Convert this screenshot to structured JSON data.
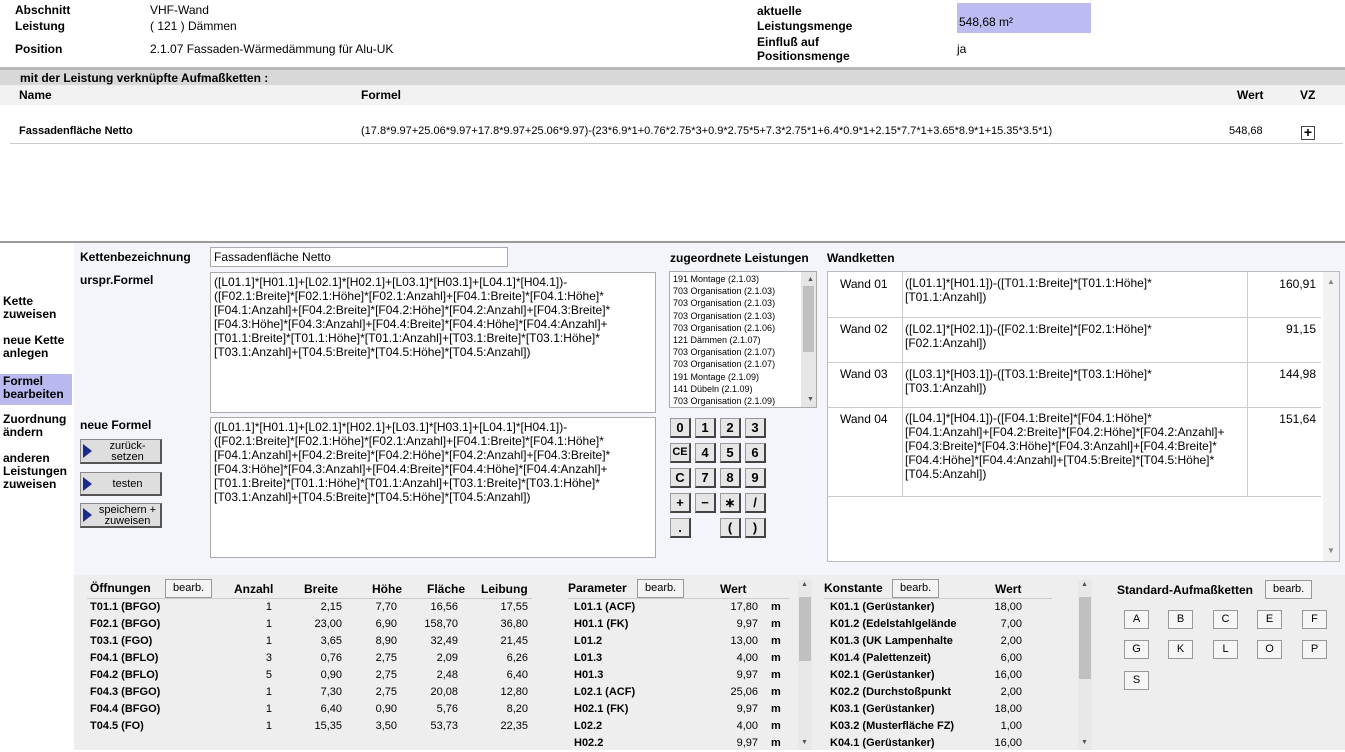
{
  "header": {
    "abschnitt_label": "Abschnitt",
    "abschnitt_value": "VHF-Wand",
    "leistung_label": "Leistung",
    "leistung_value": "( 121 ) Dämmen",
    "position_label": "Position",
    "position_value": "2.1.07 Fassaden-Wärmedämmung für Alu-UK",
    "aktuelle_label": "aktuelle",
    "leistungsmenge_label": "Leistungsmenge",
    "leistungsmenge_value": "548,68 m²",
    "einfluss_label_1": "Einfluß auf",
    "einfluss_label_2": "Positionsmenge",
    "einfluss_value": "ja"
  },
  "chains": {
    "section_title": "mit der Leistung verknüpfte Aufmaßketten :",
    "col_name": "Name",
    "col_formel": "Formel",
    "col_wert": "Wert",
    "col_vz": "VZ",
    "row": {
      "name": "Fassadenfläche Netto",
      "formel": "(17.8*9.97+25.06*9.97+17.8*9.97+25.06*9.97)-(23*6.9*1+0.76*2.75*3+0.9*2.75*5+7.3*2.75*1+6.4*0.9*1+2.15*7.7*1+3.65*8.9*1+15.35*3.5*1)",
      "wert": "548,68",
      "vz": "+"
    }
  },
  "sidebar": {
    "items": [
      {
        "label": "Kette\nzuweisen"
      },
      {
        "label": "neue Kette\nanlegen"
      },
      {
        "label": "Formel\nbearbeiten"
      },
      {
        "label": "Zuordnung\nändern"
      },
      {
        "label": "anderen\nLeistungen\nzuweisen"
      }
    ]
  },
  "editor": {
    "kettenbez_label": "Kettenbezeichnung",
    "kettenbez_value": "Fassadenfläche Netto",
    "urspr_label": "urspr.Formel",
    "urspr_value": "([L01.1]*[H01.1]+[L02.1]*[H02.1]+[L03.1]*[H03.1]+[L04.1]*[H04.1])-\n([F02.1:Breite]*[F02.1:Höhe]*[F02.1:Anzahl]+[F04.1:Breite]*[F04.1:Höhe]*\n[F04.1:Anzahl]+[F04.2:Breite]*[F04.2:Höhe]*[F04.2:Anzahl]+[F04.3:Breite]*\n[F04.3:Höhe]*[F04.3:Anzahl]+[F04.4:Breite]*[F04.4:Höhe]*[F04.4:Anzahl]+\n[T01.1:Breite]*[T01.1:Höhe]*[T01.1:Anzahl]+[T03.1:Breite]*[T03.1:Höhe]*\n[T03.1:Anzahl]+[T04.5:Breite]*[T04.5:Höhe]*[T04.5:Anzahl])",
    "neue_label": "neue Formel",
    "neue_value": "([L01.1]*[H01.1]+[L02.1]*[H02.1]+[L03.1]*[H03.1]+[L04.1]*[H04.1])-\n([F02.1:Breite]*[F02.1:Höhe]*[F02.1:Anzahl]+[F04.1:Breite]*[F04.1:Höhe]*\n[F04.1:Anzahl]+[F04.2:Breite]*[F04.2:Höhe]*[F04.2:Anzahl]+[F04.3:Breite]*\n[F04.3:Höhe]*[F04.3:Anzahl]+[F04.4:Breite]*[F04.4:Höhe]*[F04.4:Anzahl]+\n[T01.1:Breite]*[T01.1:Höhe]*[T01.1:Anzahl]+[T03.1:Breite]*[T03.1:Höhe]*\n[T03.1:Anzahl]+[T04.5:Breite]*[T04.5:Höhe]*[T04.5:Anzahl])",
    "btn_reset": "zurück-\nsetzen",
    "btn_test": "testen",
    "btn_save": "speichern +\nzuweisen"
  },
  "assigned": {
    "title": "zugeordnete Leistungen",
    "items": [
      "191 Montage (2.1.03)",
      "703 Organisation (2.1.03)",
      "703 Organisation (2.1.03)",
      "703 Organisation (2.1.03)",
      "703 Organisation (2.1.06)",
      "121 Dämmen (2.1.07)",
      "703 Organisation (2.1.07)",
      "703 Organisation (2.1.07)",
      "191 Montage (2.1.09)",
      "141 Dübeln (2.1.09)",
      "703 Organisation (2.1.09)"
    ]
  },
  "keypad": {
    "row1": [
      "0",
      "1",
      "2",
      "3"
    ],
    "row2": [
      "CE",
      "4",
      "5",
      "6"
    ],
    "row3": [
      "C",
      "7",
      "8",
      "9"
    ],
    "row4": [
      "+",
      "−",
      "∗",
      "/"
    ],
    "row5": [
      ".",
      "(",
      ")"
    ]
  },
  "wandketten": {
    "title": "Wandketten",
    "rows": [
      {
        "name": "Wand 01",
        "formel": "([L01.1]*[H01.1])-([T01.1:Breite]*[T01.1:Höhe]*\n[T01.1:Anzahl])",
        "wert": "160,91"
      },
      {
        "name": "Wand 02",
        "formel": "([L02.1]*[H02.1])-([F02.1:Breite]*[F02.1:Höhe]*\n[F02.1:Anzahl])",
        "wert": "91,15"
      },
      {
        "name": "Wand 03",
        "formel": "([L03.1]*[H03.1])-([T03.1:Breite]*[T03.1:Höhe]*\n[T03.1:Anzahl])",
        "wert": "144,98"
      },
      {
        "name": "Wand 04",
        "formel": "([L04.1]*[H04.1])-([F04.1:Breite]*[F04.1:Höhe]*\n[F04.1:Anzahl]+[F04.2:Breite]*[F04.2:Höhe]*[F04.2:Anzahl]+\n[F04.3:Breite]*[F04.3:Höhe]*[F04.3:Anzahl]+[F04.4:Breite]*\n[F04.4:Höhe]*[F04.4:Anzahl]+[T04.5:Breite]*[T04.5:Höhe]*\n[T04.5:Anzahl])",
        "wert": "151,64"
      }
    ]
  },
  "oeffnungen": {
    "title": "Öffnungen",
    "edit": "bearb.",
    "cols": [
      "Anzahl",
      "Breite",
      "Höhe",
      "Fläche",
      "Leibung"
    ],
    "rows": [
      [
        "T01.1 (BFGO)",
        "1",
        "2,15",
        "7,70",
        "16,56",
        "17,55"
      ],
      [
        "F02.1 (BFGO)",
        "1",
        "23,00",
        "6,90",
        "158,70",
        "36,80"
      ],
      [
        "T03.1 (FGO)",
        "1",
        "3,65",
        "8,90",
        "32,49",
        "21,45"
      ],
      [
        "F04.1 (BFLO)",
        "3",
        "0,76",
        "2,75",
        "2,09",
        "6,26"
      ],
      [
        "F04.2 (BFLO)",
        "5",
        "0,90",
        "2,75",
        "2,48",
        "6,40"
      ],
      [
        "F04.3 (BFGO)",
        "1",
        "7,30",
        "2,75",
        "20,08",
        "12,80"
      ],
      [
        "F04.4 (BFGO)",
        "1",
        "6,40",
        "0,90",
        "5,76",
        "8,20"
      ],
      [
        "T04.5 (FO)",
        "1",
        "15,35",
        "3,50",
        "53,73",
        "22,35"
      ]
    ]
  },
  "parameter": {
    "title": "Parameter",
    "edit": "bearb.",
    "col_wert": "Wert",
    "rows": [
      [
        "L01.1 (ACF)",
        "17,80",
        "m"
      ],
      [
        "H01.1 (FK)",
        "9,97",
        "m"
      ],
      [
        "L01.2",
        "13,00",
        "m"
      ],
      [
        "L01.3",
        "4,00",
        "m"
      ],
      [
        "H01.3",
        "9,97",
        "m"
      ],
      [
        "L02.1 (ACF)",
        "25,06",
        "m"
      ],
      [
        "H02.1 (FK)",
        "9,97",
        "m"
      ],
      [
        "L02.2",
        "4,00",
        "m"
      ],
      [
        "H02.2",
        "9,97",
        "m"
      ]
    ]
  },
  "konstante": {
    "title": "Konstante",
    "edit": "bearb.",
    "col_wert": "Wert",
    "rows": [
      [
        "K01.1 (Gerüstanker)",
        "18,00"
      ],
      [
        "K01.2 (Edelstahlgelände",
        "7,00"
      ],
      [
        "K01.3 (UK Lampenhalte",
        "2,00"
      ],
      [
        "K01.4 (Palettenzeit)",
        "6,00"
      ],
      [
        "K02.1 (Gerüstanker)",
        "16,00"
      ],
      [
        "K02.2 (Durchstoßpunkt",
        "2,00"
      ],
      [
        "K03.1 (Gerüstanker)",
        "18,00"
      ],
      [
        "K03.2 (Musterfläche FZ)",
        "1,00"
      ],
      [
        "K04.1 (Gerüstanker)",
        "16,00"
      ]
    ]
  },
  "standard": {
    "title": "Standard-Aufmaßketten",
    "edit": "bearb.",
    "buttons": [
      "A",
      "B",
      "C",
      "E",
      "F",
      "G",
      "K",
      "L",
      "O",
      "P",
      "S"
    ]
  },
  "colors": {
    "highlight": "#bcbcf2",
    "active_sidebar": "#b9b9ef",
    "arrow_blue": "#1a2a8e",
    "panel_bg": "#f3f5fa"
  }
}
